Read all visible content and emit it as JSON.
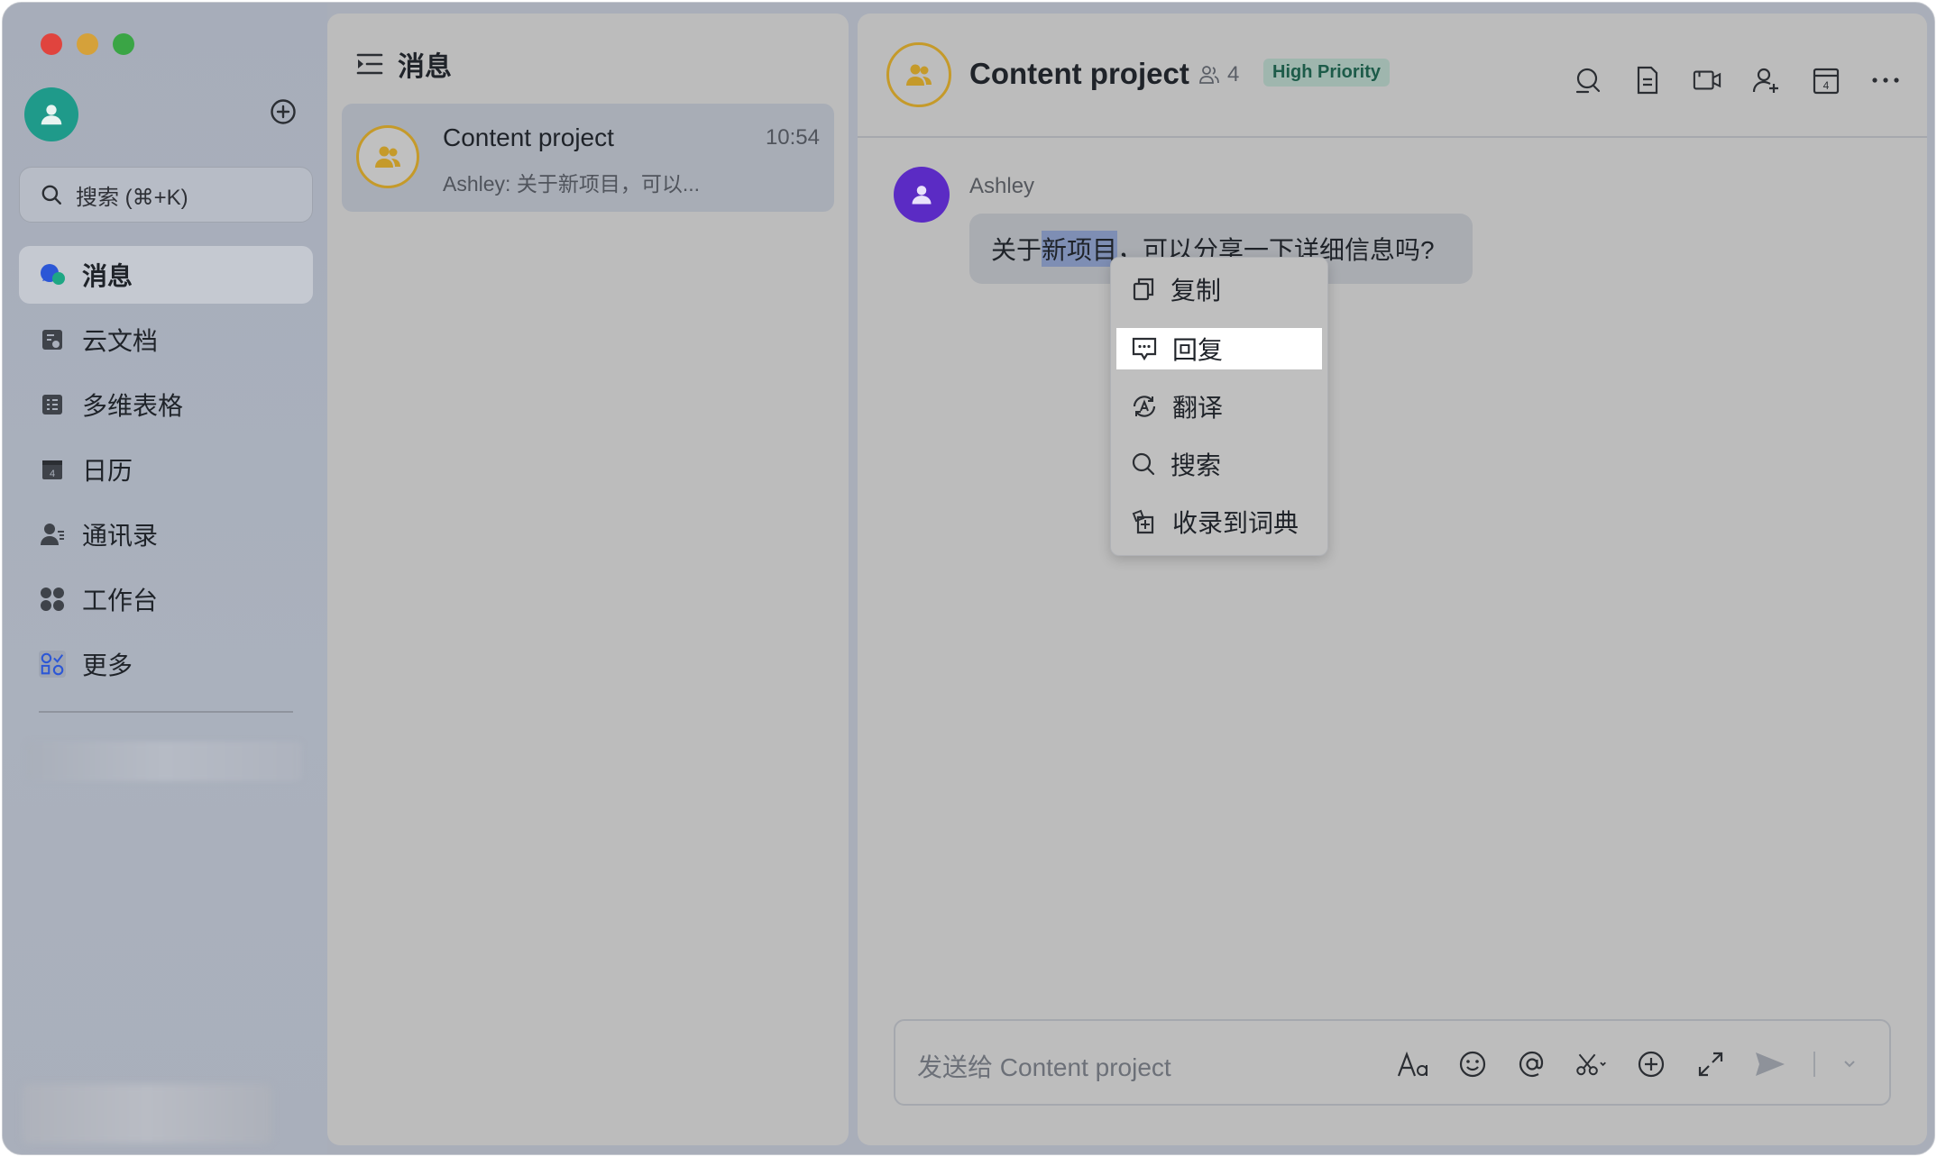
{
  "window": {
    "controls": [
      "close",
      "minimize",
      "zoom"
    ]
  },
  "sidebar": {
    "search_placeholder": "搜索 (⌘+K)",
    "items": [
      {
        "label": "消息",
        "icon": "chat-bubble-icon",
        "active": true
      },
      {
        "label": "云文档",
        "icon": "cloud-doc-icon"
      },
      {
        "label": "多维表格",
        "icon": "table-icon"
      },
      {
        "label": "日历",
        "icon": "calendar-icon"
      },
      {
        "label": "通讯录",
        "icon": "contacts-icon"
      },
      {
        "label": "工作台",
        "icon": "workspace-icon"
      },
      {
        "label": "更多",
        "icon": "more-apps-icon"
      }
    ]
  },
  "list": {
    "title": "消息",
    "chats": [
      {
        "name": "Content project",
        "time": "10:54",
        "preview": "Ashley: 关于新项目，可以..."
      }
    ]
  },
  "chat": {
    "title": "Content project",
    "members": "4",
    "badge": "High Priority",
    "message": {
      "sender": "Ashley",
      "text_before": "关于",
      "text_selected": "新项目",
      "text_after": "，可以分享一下详细信息吗?"
    },
    "composer_placeholder": "发送给 Content project"
  },
  "context_menu": {
    "items": [
      {
        "label": "复制",
        "icon": "copy-icon"
      },
      {
        "label": "回复",
        "icon": "reply-icon",
        "highlighted": true
      },
      {
        "label": "翻译",
        "icon": "translate-icon"
      },
      {
        "label": "搜索",
        "icon": "search-icon"
      },
      {
        "label": "收录到词典",
        "icon": "dictionary-icon"
      }
    ]
  },
  "colors": {
    "accent_gold": "#c59a2a",
    "badge_bg": "#9fb6ae",
    "badge_text": "#1d5b49",
    "ashley_avatar": "#5b2bc4",
    "me_avatar": "#1f9a8a"
  }
}
